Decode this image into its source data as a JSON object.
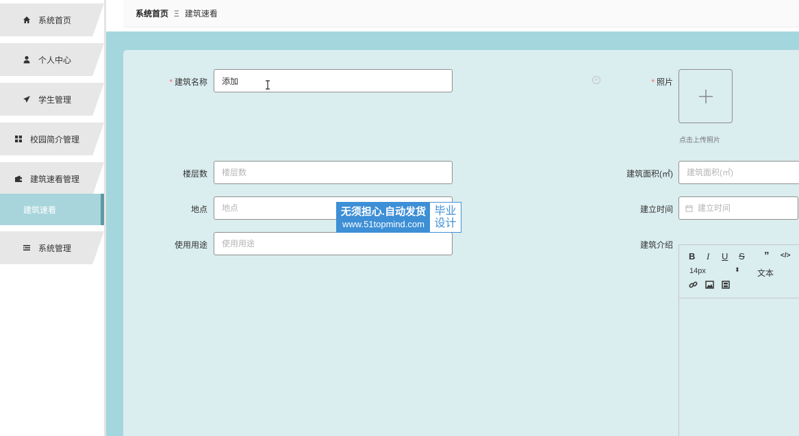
{
  "sidebar": {
    "items": [
      {
        "label": "系统首页",
        "icon": "home-icon"
      },
      {
        "label": "个人中心",
        "icon": "user-icon"
      },
      {
        "label": "学生管理",
        "icon": "paper-plane-icon"
      },
      {
        "label": "校园简介管理",
        "icon": "grid-icon"
      },
      {
        "label": "建筑速看管理",
        "icon": "wallet-icon"
      },
      {
        "label": "系统管理",
        "icon": "list-icon"
      }
    ],
    "active_sub": "建筑速看"
  },
  "breadcrumb": {
    "home": "系统首页",
    "separator": "Ξ",
    "current": "建筑速看"
  },
  "form": {
    "name": {
      "label": "建筑名称",
      "value": "添加",
      "required": true
    },
    "floors": {
      "label": "楼层数",
      "placeholder": "楼层数"
    },
    "location": {
      "label": "地点",
      "placeholder": "地点"
    },
    "usage": {
      "label": "使用用途",
      "placeholder": "使用用途"
    },
    "photo": {
      "label": "照片",
      "required": true,
      "hint": "点击上传照片"
    },
    "area": {
      "label": "建筑面积(㎡)",
      "placeholder": "建筑面积(㎡)"
    },
    "built_time": {
      "label": "建立时间",
      "placeholder": "建立时间"
    },
    "intro": {
      "label": "建筑介绍"
    }
  },
  "editor": {
    "font_size": "14px",
    "text_style": "文本"
  },
  "watermark": {
    "line1": "无须担心.自动发货",
    "line2": "www.51topmind.com",
    "right1": "毕业",
    "right2": "设计"
  },
  "colors": {
    "teal_band": "#a4d7dd",
    "panel": "#daedef",
    "active_sub": "#a8d5dc",
    "required": "#f56c6c",
    "watermark_blue": "#3d8fd6"
  }
}
